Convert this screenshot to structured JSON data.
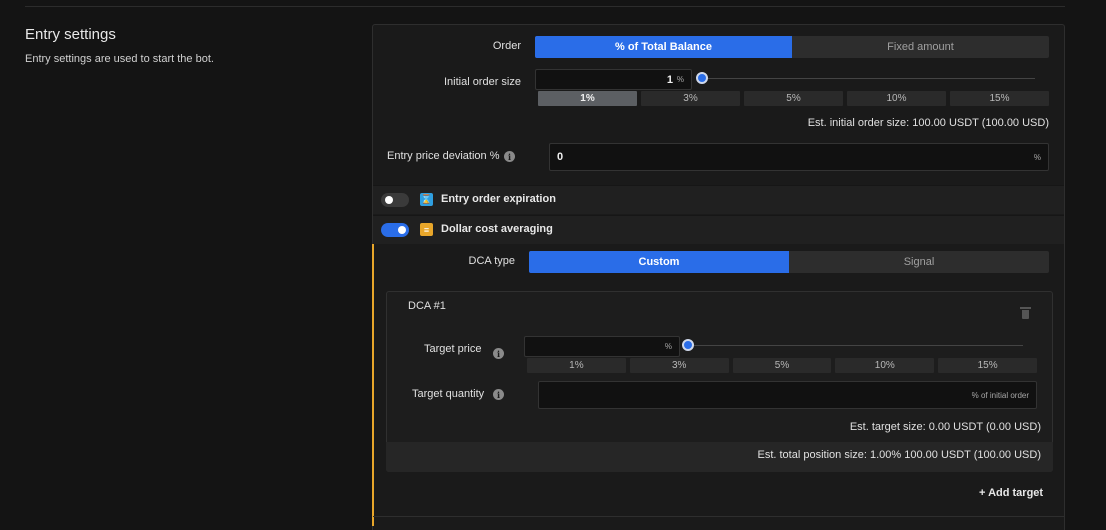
{
  "section": {
    "title": "Entry settings",
    "description": "Entry settings are used to start the bot."
  },
  "order": {
    "label": "Order",
    "options": [
      "% of Total Balance",
      "Fixed amount"
    ],
    "selected": "% of Total Balance"
  },
  "initial_order": {
    "label": "Initial order size",
    "value": "1",
    "unit": "%",
    "slider_fraction": 0.0,
    "presets": [
      "1%",
      "3%",
      "5%",
      "10%",
      "15%"
    ],
    "active_preset": "1%",
    "estimate": "Est. initial order size: 100.00 USDT (100.00 USD)"
  },
  "entry_deviation": {
    "label": "Entry price deviation %",
    "value": "0",
    "unit": "%"
  },
  "features": {
    "expiration": {
      "label": "Entry order expiration",
      "enabled": false,
      "icon": "hourglass-icon",
      "color": "#2f9fe0"
    },
    "dca": {
      "label": "Dollar cost averaging",
      "enabled": true,
      "icon": "dca-icon",
      "color": "#e8a62a"
    }
  },
  "dca": {
    "type_label": "DCA type",
    "type_options": [
      "Custom",
      "Signal"
    ],
    "type_selected": "Custom",
    "card": {
      "title": "DCA #1",
      "target_price_label": "Target price",
      "target_price_value": "",
      "target_price_unit": "%",
      "slider_fraction": 0.0,
      "presets": [
        "1%",
        "3%",
        "5%",
        "10%",
        "15%"
      ],
      "target_quantity_label": "Target quantity",
      "target_quantity_value": "",
      "target_quantity_unit": "% of initial order",
      "est_target": "Est. target size: 0.00 USDT (0.00 USD)",
      "est_total": "Est. total position size: 1.00% 100.00 USDT (100.00 USD)"
    },
    "add_target_label": "+ Add target"
  },
  "colors": {
    "accent": "#2a6de8",
    "dca_accent": "#e8a62a",
    "background": "#141414",
    "panel": "#1a1a1a"
  }
}
